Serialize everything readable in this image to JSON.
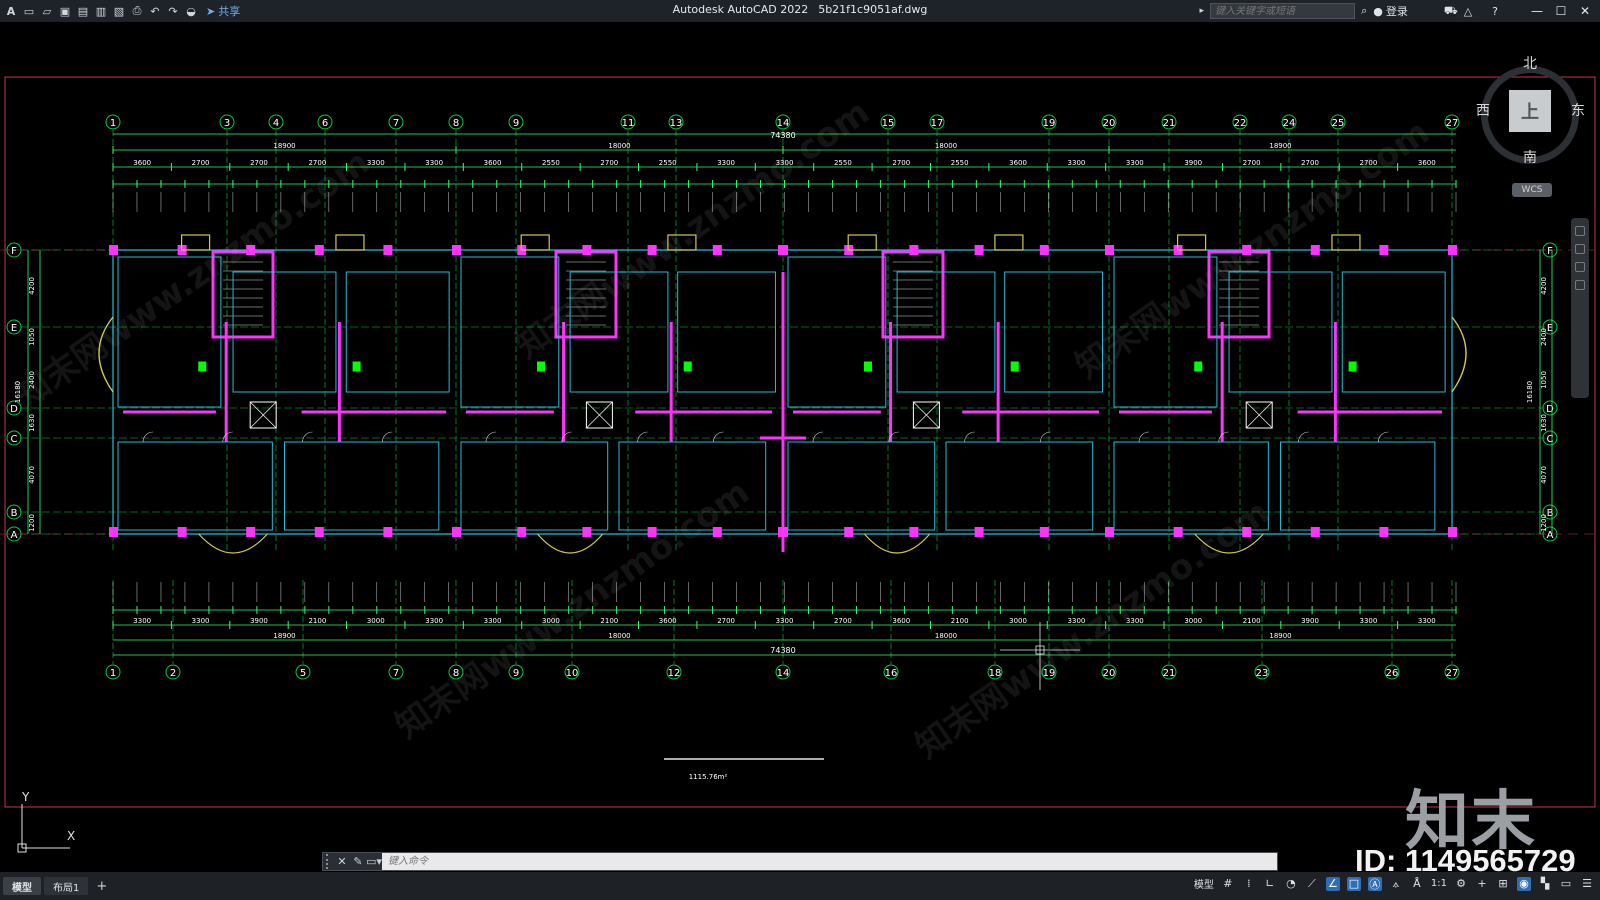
{
  "titlebar": {
    "app_name": "Autodesk AutoCAD 2022",
    "file_name": "5b21f1c9051af.dwg",
    "share_label": "共享",
    "search_placeholder": "键入关键字或短语",
    "login_label": "登录"
  },
  "viewcube": {
    "north": "北",
    "south": "南",
    "east": "东",
    "west": "西",
    "face": "上",
    "wcs": "WCS"
  },
  "drawing": {
    "top_axes": [
      "1",
      "3",
      "4",
      "6",
      "7",
      "8",
      "9",
      "11",
      "13",
      "14",
      "15",
      "17",
      "19",
      "20",
      "21",
      "22",
      "24",
      "25",
      "27"
    ],
    "bottom_axes": [
      "1",
      "2",
      "5",
      "7",
      "8",
      "9",
      "10",
      "12",
      "14",
      "16",
      "18",
      "19",
      "20",
      "21",
      "23",
      "26",
      "27"
    ],
    "row_axes": [
      "F",
      "E",
      "D",
      "C",
      "B",
      "A"
    ],
    "overall_length": "74380",
    "segment_dims": [
      "18900",
      "18000",
      "18000",
      "18900"
    ],
    "top_mid_dims": [
      "3600",
      "2700",
      "2700",
      "2700",
      "3300",
      "3300",
      "3600",
      "2550",
      "2700",
      "2550",
      "3300",
      "3300",
      "2550",
      "2700",
      "2550",
      "3600",
      "3300",
      "3300",
      "3900",
      "2700",
      "2700",
      "2700",
      "3600"
    ],
    "bottom_mid_dims": [
      "3300",
      "3300",
      "3900",
      "2100",
      "3000",
      "3300",
      "3300",
      "3000",
      "2100",
      "3600",
      "2700",
      "3300",
      "2700",
      "3600",
      "2100",
      "3000",
      "3300",
      "3300",
      "3000",
      "2100",
      "3900",
      "3300",
      "3300"
    ],
    "left_dims": [
      "4200",
      "1050",
      "2400",
      "1630",
      "4070",
      "1200"
    ],
    "right_dims": [
      "4200",
      "2400",
      "1050",
      "1630",
      "4070",
      "1200"
    ],
    "total_height_left": "16180",
    "total_height_right": "16180",
    "area_text": "1115.76m²"
  },
  "watermark": {
    "logo_text": "知末",
    "id_text": "ID: 1149565729",
    "ghost_text": "知末网www.znzmo.com"
  },
  "command": {
    "placeholder": "键入命令"
  },
  "statusbar": {
    "tabs": [
      "模型",
      "布局1"
    ],
    "model_label": "模型",
    "scale_label": "1:1"
  },
  "ucs": {
    "x_label": "X",
    "y_label": "Y"
  },
  "colors": {
    "wall": "#ff33ff",
    "axis": "#00cc44",
    "dimension": "#33ff66",
    "frame": "#c0394b",
    "balcony": "#d4c84a",
    "partition": "#22bcd4",
    "text": "#ffffff"
  }
}
